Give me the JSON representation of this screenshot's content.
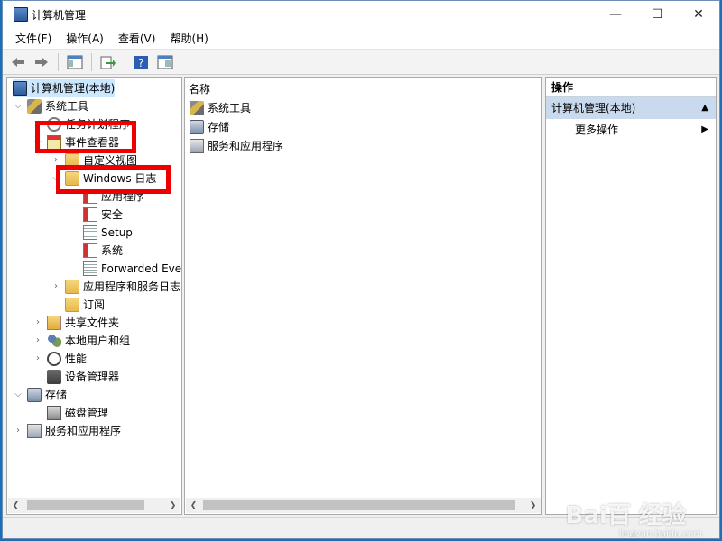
{
  "window": {
    "title": "计算机管理",
    "minimize": "—",
    "maximize": "☐",
    "close": "✕"
  },
  "menu": [
    "文件(F)",
    "操作(A)",
    "查看(V)",
    "帮助(H)"
  ],
  "toolbar": {
    "icons": [
      "back-icon",
      "forward-icon",
      "show-tree-icon",
      "export-icon",
      "help-icon",
      "properties-icon"
    ]
  },
  "tree": {
    "root": "计算机管理(本地)",
    "system_tools": "系统工具",
    "task_scheduler": "任务计划程序",
    "event_viewer": "事件查看器",
    "custom_views": "自定义视图",
    "windows_logs": "Windows 日志",
    "app_log": "应用程序",
    "security_log": "安全",
    "setup_log": "Setup",
    "system_log": "系统",
    "forwarded_log": "Forwarded Eve",
    "app_service_logs": "应用程序和服务日志",
    "subscriptions": "订阅",
    "shared_folders": "共享文件夹",
    "local_users": "本地用户和组",
    "performance": "性能",
    "device_manager": "设备管理器",
    "storage": "存储",
    "disk_management": "磁盘管理",
    "services_apps": "服务和应用程序"
  },
  "content": {
    "column_header": "名称",
    "items": [
      "系统工具",
      "存储",
      "服务和应用程序"
    ]
  },
  "actions": {
    "header": "操作",
    "section": "计算机管理(本地)",
    "more": "更多操作"
  },
  "watermark": {
    "main": "Bai百 经验",
    "sub": "jingyan.baidu.com"
  },
  "colors": {
    "highlight_box": "#ee0000",
    "selection": "#cce8ff",
    "action_section": "#c9d9ee"
  }
}
